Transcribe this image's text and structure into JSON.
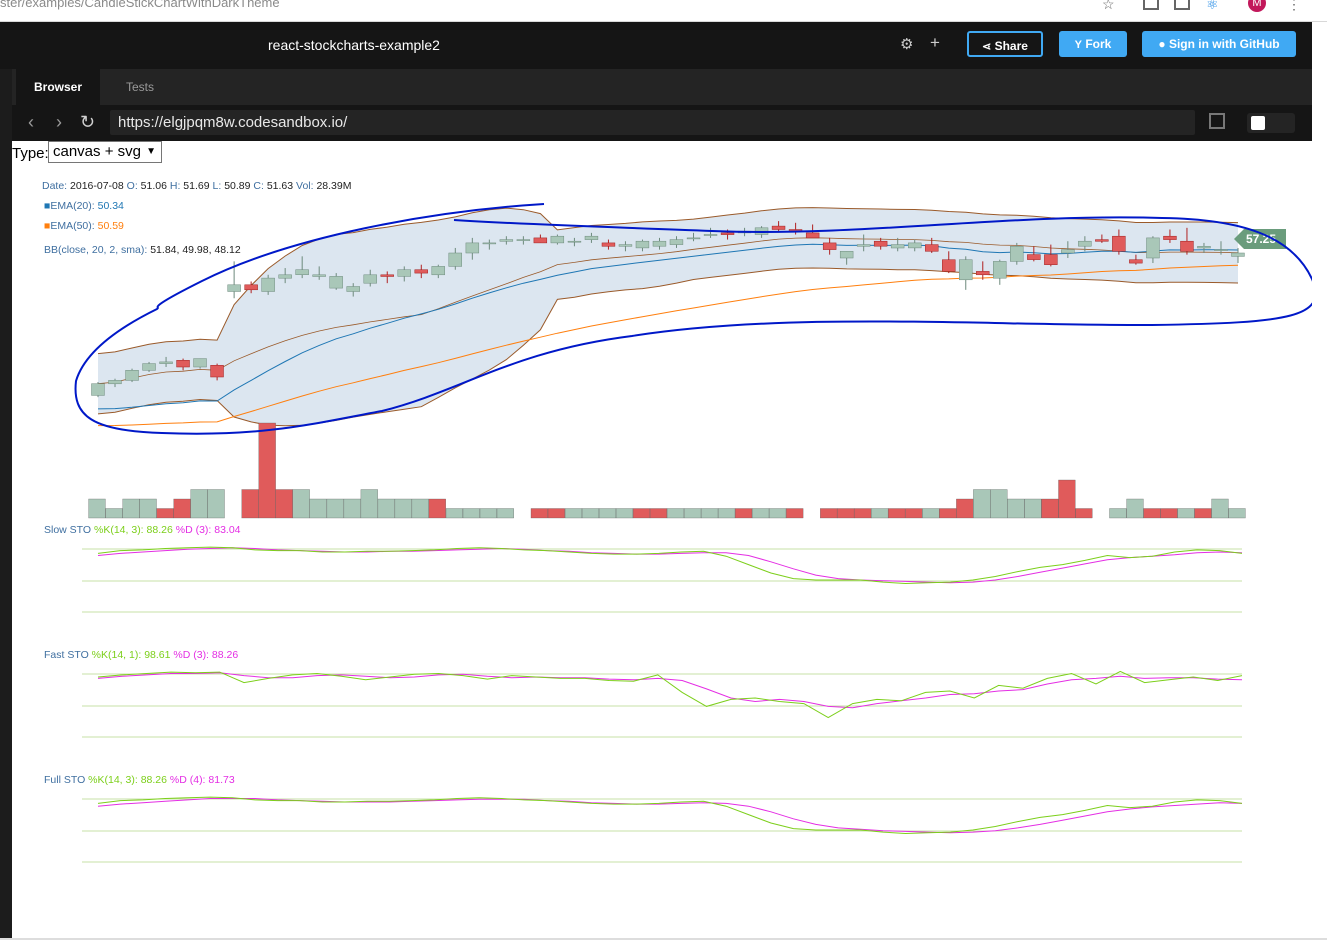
{
  "browser": {
    "url_fragment": "ster/examples/CandleStickChartWithDarkTheme",
    "avatar_letter": "M"
  },
  "sandbox": {
    "title": "react-stockcharts-example2",
    "share_label": "Share",
    "fork_label": "Fork",
    "signin_label": "Sign in with GitHub",
    "tabs": [
      {
        "label": "Browser"
      },
      {
        "label": "Tests"
      }
    ],
    "preview_url": "https://elgjpqm8w.codesandbox.io/"
  },
  "type_selector": {
    "label": "Type:",
    "value": "canvas + svg"
  },
  "chart_data": {
    "type": "candlestick",
    "tooltip": {
      "date_label": "Date:",
      "date": "2016-07-08",
      "o_label": "O:",
      "o": "51.06",
      "h_label": "H:",
      "h": "51.69",
      "l_label": "L:",
      "l": "50.89",
      "c_label": "C:",
      "c": "51.63",
      "vol_label": "Vol:",
      "vol": "28.39M"
    },
    "ema20": {
      "label": "EMA(20):",
      "value": "50.34",
      "color": "#1f77b4"
    },
    "ema50": {
      "label": "EMA(50):",
      "value": "50.59",
      "color": "#ff7f0e"
    },
    "bb": {
      "label": "BB(close, 20, 2, sma):",
      "value": "51.84, 49.98, 48.12"
    },
    "last_price": "57.25",
    "colors": {
      "up": "#a9c7b8",
      "down": "#e05b5b",
      "stoch_k": "#7ccf1a",
      "stoch_d": "#e42ee4",
      "annotation": "#0018c8"
    },
    "candles": [
      [
        43.4,
        44.2,
        43.3,
        44.1
      ],
      [
        44.1,
        44.4,
        43.9,
        44.3
      ],
      [
        44.3,
        45.0,
        44.2,
        44.9
      ],
      [
        44.9,
        45.4,
        44.8,
        45.3
      ],
      [
        45.3,
        45.7,
        45.1,
        45.4
      ],
      [
        45.5,
        45.6,
        44.9,
        45.1
      ],
      [
        45.1,
        45.6,
        45.0,
        45.6
      ],
      [
        45.2,
        45.3,
        44.3,
        44.5
      ],
      [
        49.6,
        51.4,
        49.2,
        50.0
      ],
      [
        50.0,
        50.2,
        49.5,
        49.7
      ],
      [
        49.6,
        50.6,
        49.4,
        50.4
      ],
      [
        50.4,
        51.0,
        50.1,
        50.6
      ],
      [
        50.6,
        51.7,
        50.4,
        50.9
      ],
      [
        50.5,
        51.1,
        50.3,
        50.6
      ],
      [
        49.8,
        50.7,
        49.7,
        50.5
      ],
      [
        49.6,
        50.1,
        49.3,
        49.9
      ],
      [
        50.1,
        50.9,
        49.9,
        50.6
      ],
      [
        50.6,
        50.8,
        50.1,
        50.5
      ],
      [
        50.5,
        51.1,
        50.2,
        50.9
      ],
      [
        50.9,
        51.2,
        50.4,
        50.7
      ],
      [
        50.6,
        51.2,
        50.4,
        51.1
      ],
      [
        51.1,
        52.2,
        50.9,
        51.9
      ],
      [
        51.9,
        52.8,
        51.5,
        52.5
      ],
      [
        52.5,
        52.7,
        52.1,
        52.5
      ],
      [
        52.6,
        52.9,
        52.4,
        52.7
      ],
      [
        52.7,
        52.9,
        52.4,
        52.7
      ],
      [
        52.8,
        53.0,
        52.5,
        52.5
      ],
      [
        52.5,
        53.0,
        52.4,
        52.9
      ],
      [
        52.6,
        52.8,
        52.3,
        52.6
      ],
      [
        52.7,
        53.1,
        52.5,
        52.9
      ],
      [
        52.5,
        52.7,
        52.1,
        52.3
      ],
      [
        52.3,
        52.6,
        52.0,
        52.4
      ],
      [
        52.2,
        52.7,
        52.0,
        52.6
      ],
      [
        52.3,
        52.8,
        52.1,
        52.6
      ],
      [
        52.4,
        52.9,
        52.2,
        52.7
      ],
      [
        52.8,
        53.1,
        52.6,
        52.8
      ],
      [
        53.0,
        53.4,
        52.8,
        53.0
      ],
      [
        53.1,
        53.3,
        52.7,
        53.0
      ],
      [
        53.1,
        53.4,
        52.9,
        53.2
      ],
      [
        53.0,
        53.5,
        52.8,
        53.4
      ],
      [
        53.5,
        53.8,
        53.2,
        53.3
      ],
      [
        53.3,
        53.7,
        53.0,
        53.2
      ],
      [
        53.1,
        53.6,
        52.8,
        52.8
      ],
      [
        52.5,
        52.8,
        51.8,
        52.1
      ],
      [
        51.6,
        52.0,
        51.2,
        52.0
      ],
      [
        52.3,
        53.0,
        52.0,
        52.4
      ],
      [
        52.6,
        52.8,
        52.1,
        52.3
      ],
      [
        52.2,
        52.8,
        52.0,
        52.4
      ],
      [
        52.2,
        52.7,
        52.0,
        52.5
      ],
      [
        52.4,
        52.8,
        51.9,
        52.0
      ],
      [
        51.5,
        52.0,
        50.7,
        50.8
      ],
      [
        50.3,
        51.7,
        49.7,
        51.5
      ],
      [
        50.8,
        51.4,
        50.3,
        50.6
      ],
      [
        50.4,
        51.5,
        50.0,
        51.4
      ],
      [
        51.4,
        52.5,
        51.2,
        52.3
      ],
      [
        51.8,
        52.3,
        51.4,
        51.5
      ],
      [
        51.8,
        52.4,
        51.1,
        51.2
      ],
      [
        51.9,
        52.6,
        51.6,
        52.1
      ],
      [
        52.3,
        52.9,
        52.0,
        52.6
      ],
      [
        52.7,
        53.0,
        52.5,
        52.6
      ],
      [
        52.9,
        53.3,
        51.8,
        52.0
      ],
      [
        51.5,
        51.8,
        51.2,
        51.3
      ],
      [
        51.6,
        52.9,
        51.3,
        52.8
      ],
      [
        52.9,
        53.3,
        52.5,
        52.7
      ],
      [
        52.6,
        53.4,
        51.8,
        52.0
      ],
      [
        52.2,
        52.5,
        51.9,
        52.3
      ],
      [
        52.1,
        52.6,
        51.8,
        52.1
      ],
      [
        51.7,
        52.2,
        51.3,
        51.9
      ]
    ],
    "volume": [
      [
        1,
        2
      ],
      [
        1,
        1
      ],
      [
        1,
        2
      ],
      [
        1,
        2
      ],
      [
        -1,
        1
      ],
      [
        -1,
        2
      ],
      [
        1,
        3
      ],
      [
        1,
        3
      ],
      [
        -1,
        3
      ],
      [
        -1,
        10
      ],
      [
        -1,
        3
      ],
      [
        1,
        3
      ],
      [
        1,
        2
      ],
      [
        1,
        2
      ],
      [
        1,
        2
      ],
      [
        1,
        3
      ],
      [
        1,
        2
      ],
      [
        1,
        2
      ],
      [
        1,
        2
      ],
      [
        -1,
        2
      ],
      [
        1,
        1
      ],
      [
        1,
        1
      ],
      [
        1,
        1
      ],
      [
        1,
        1
      ],
      [
        -1,
        1
      ],
      [
        -1,
        1
      ],
      [
        1,
        1
      ],
      [
        1,
        1
      ],
      [
        1,
        1
      ],
      [
        1,
        1
      ],
      [
        -1,
        1
      ],
      [
        -1,
        1
      ],
      [
        1,
        1
      ],
      [
        1,
        1
      ],
      [
        1,
        1
      ],
      [
        1,
        1
      ],
      [
        -1,
        1
      ],
      [
        1,
        1
      ],
      [
        1,
        1
      ],
      [
        -1,
        1
      ],
      [
        -1,
        1
      ],
      [
        -1,
        1
      ],
      [
        -1,
        1
      ],
      [
        1,
        1
      ],
      [
        -1,
        1
      ],
      [
        -1,
        1
      ],
      [
        1,
        1
      ],
      [
        -1,
        1
      ],
      [
        -1,
        2
      ],
      [
        1,
        3
      ],
      [
        1,
        3
      ],
      [
        1,
        2
      ],
      [
        1,
        2
      ],
      [
        -1,
        2
      ],
      [
        -1,
        4
      ],
      [
        -1,
        1
      ],
      [
        1,
        1
      ],
      [
        1,
        2
      ],
      [
        -1,
        1
      ],
      [
        -1,
        1
      ],
      [
        1,
        1
      ],
      [
        -1,
        1
      ],
      [
        1,
        2
      ],
      [
        1,
        1
      ]
    ],
    "stochastics": [
      {
        "name": "Slow STO",
        "k_label": "%K(14, 3):",
        "k_value": "88.26",
        "d_label": "%D (3):",
        "d_value": "83.04",
        "k": [
          88,
          92,
          93,
          95,
          96,
          97,
          96,
          93,
          92,
          92,
          90,
          90,
          91,
          91,
          92,
          93,
          95,
          96,
          95,
          93,
          92,
          90,
          88,
          87,
          87,
          88,
          90,
          91,
          84,
          72,
          60,
          52,
          50,
          50,
          50,
          47,
          45,
          46,
          47,
          50,
          55,
          62,
          68,
          72,
          78,
          85,
          82,
          84,
          90,
          93,
          92,
          88
        ],
        "d": [
          85,
          88,
          90,
          92,
          94,
          95,
          96,
          95,
          93,
          92,
          91,
          90,
          90,
          91,
          91,
          92,
          93,
          94,
          95,
          94,
          92,
          91,
          89,
          88,
          87,
          87,
          88,
          89,
          89,
          85,
          76,
          66,
          57,
          52,
          50,
          49,
          48,
          47,
          46,
          47,
          50,
          55,
          61,
          67,
          73,
          79,
          82,
          84,
          86,
          89,
          90,
          89
        ]
      },
      {
        "name": "Fast STO",
        "k_label": "%K(14, 1):",
        "k_value": "98.61",
        "d_label": "%D (3):",
        "d_value": "88.26",
        "k": [
          90,
          93,
          95,
          97,
          96,
          97,
          82,
          88,
          93,
          95,
          91,
          86,
          90,
          94,
          95,
          92,
          87,
          92,
          90,
          88,
          88,
          85,
          84,
          93,
          68,
          48,
          58,
          60,
          55,
          52,
          32,
          52,
          58,
          56,
          68,
          70,
          60,
          78,
          74,
          88,
          95,
          80,
          98,
          82,
          86,
          90,
          85,
          92
        ],
        "d": [
          88,
          91,
          93,
          95,
          95,
          96,
          92,
          89,
          89,
          92,
          93,
          91,
          89,
          90,
          93,
          94,
          91,
          89,
          90,
          89,
          89,
          87,
          86,
          88,
          85,
          73,
          60,
          55,
          58,
          55,
          48,
          46,
          52,
          56,
          60,
          65,
          66,
          70,
          72,
          80,
          86,
          88,
          91,
          88,
          89,
          89,
          87,
          86
        ]
      },
      {
        "name": "Full STO",
        "k_label": "%K(14, 3):",
        "k_value": "88.26",
        "d_label": "%D (4):",
        "d_value": "81.73",
        "k": [
          88,
          92,
          93,
          95,
          96,
          97,
          96,
          93,
          92,
          92,
          90,
          90,
          91,
          91,
          92,
          93,
          95,
          96,
          95,
          93,
          92,
          90,
          88,
          87,
          87,
          88,
          90,
          91,
          84,
          72,
          60,
          52,
          50,
          50,
          50,
          47,
          45,
          46,
          47,
          50,
          55,
          62,
          68,
          72,
          78,
          85,
          82,
          84,
          90,
          93,
          92,
          88
        ],
        "d": [
          84,
          87,
          89,
          91,
          93,
          95,
          95,
          95,
          93,
          92,
          91,
          90,
          90,
          90,
          91,
          92,
          93,
          94,
          94,
          94,
          92,
          91,
          89,
          88,
          87,
          87,
          88,
          89,
          88,
          84,
          76,
          66,
          58,
          53,
          51,
          49,
          48,
          47,
          46,
          47,
          49,
          53,
          58,
          64,
          70,
          76,
          80,
          83,
          85,
          87,
          89,
          88
        ]
      }
    ]
  }
}
